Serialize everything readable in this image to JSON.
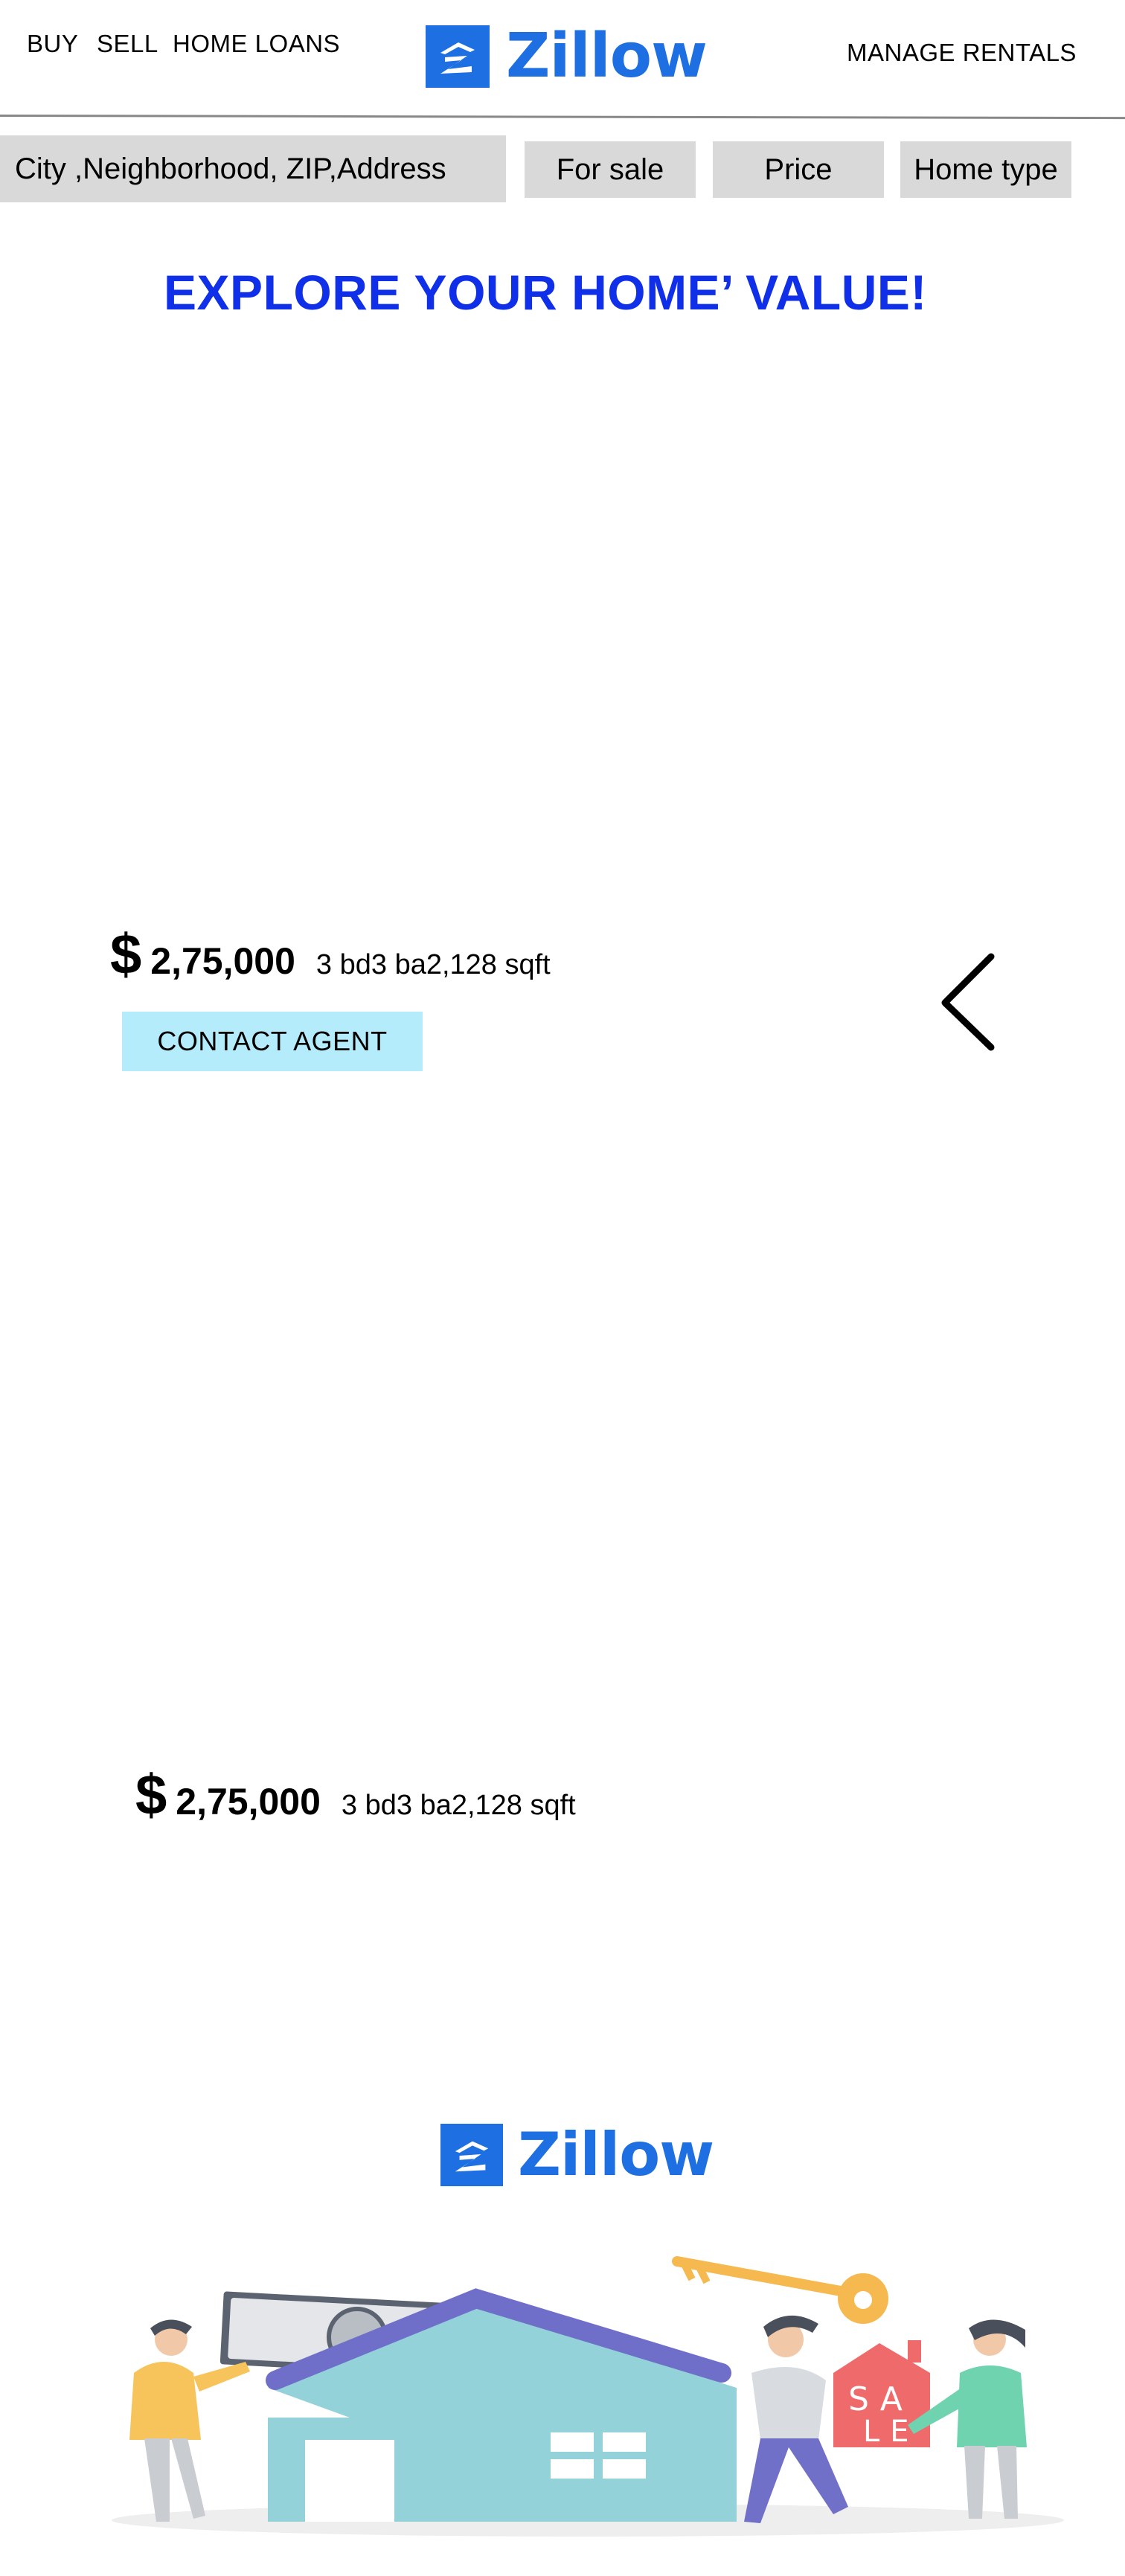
{
  "nav": {
    "buy": "BUY",
    "sell": "SELL",
    "home_loans": "HOME LOANS",
    "manage_rentals": "MANAGE RENTALS"
  },
  "brand": {
    "name": "Zillow",
    "color": "#1d6fe2"
  },
  "filters": {
    "location": "City ,Neighborhood, ZIP,Address",
    "status": "For sale",
    "price": "Price",
    "home_type": "Home type"
  },
  "hero": {
    "title": "EXPLORE YOUR HOME’ VALUE!",
    "color": "#0f2fe8"
  },
  "listings": [
    {
      "currency": "$",
      "price": "2,75,000",
      "details": "3 bd3 ba2,128 sqft",
      "cta": "CONTACT AGENT"
    },
    {
      "currency": "$",
      "price": "2,75,000",
      "details": "3 bd3 ba2,128 sqft"
    }
  ],
  "icons": {
    "carousel": "chevron-left-icon",
    "logo": "zillow-house-icon"
  },
  "colors": {
    "filter_bg": "#d9d9d9",
    "cta_bg": "#b5ecfb"
  }
}
